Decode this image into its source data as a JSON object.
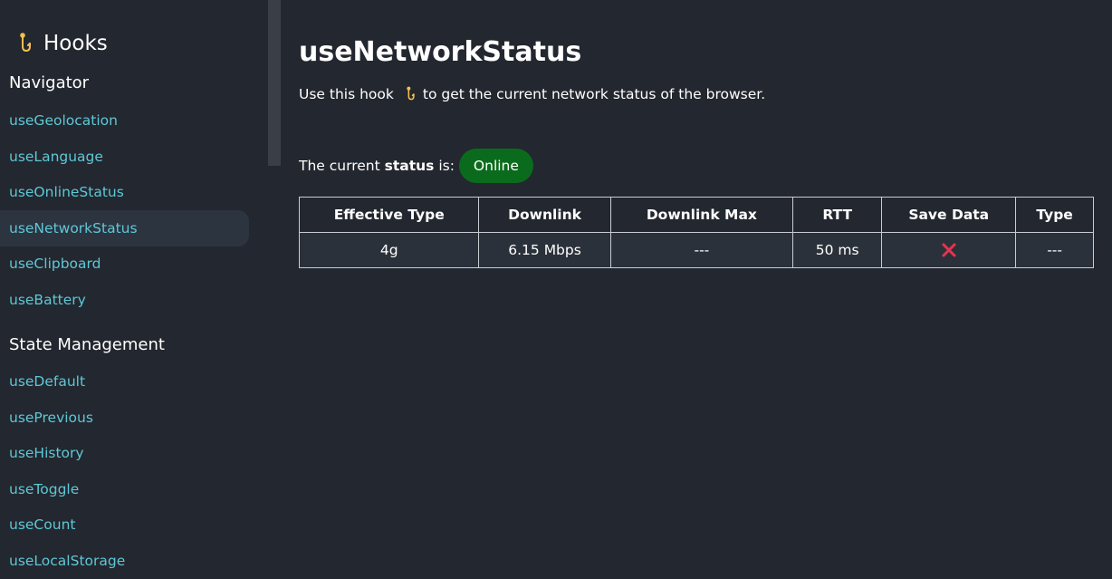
{
  "brand": {
    "title": "Hooks",
    "icon": "hook-icon"
  },
  "sidebar": {
    "sections": [
      {
        "heading": "Navigator",
        "items": [
          {
            "label": "useGeolocation"
          },
          {
            "label": "useLanguage"
          },
          {
            "label": "useOnlineStatus"
          },
          {
            "label": "useNetworkStatus",
            "active": true
          },
          {
            "label": "useClipboard"
          },
          {
            "label": "useBattery"
          }
        ]
      },
      {
        "heading": "State Management",
        "items": [
          {
            "label": "useDefault"
          },
          {
            "label": "usePrevious"
          },
          {
            "label": "useHistory"
          },
          {
            "label": "useToggle"
          },
          {
            "label": "useCount"
          },
          {
            "label": "useLocalStorage"
          }
        ]
      }
    ]
  },
  "main": {
    "title": "useNetworkStatus",
    "description_prefix": "Use this hook",
    "description_suffix": "to get the current network status of the browser.",
    "status_prefix": "The current",
    "status_bold": "status",
    "status_suffix": "is:",
    "status_value": "Online",
    "table": {
      "headers": [
        "Effective Type",
        "Downlink",
        "Downlink Max",
        "RTT",
        "Save Data",
        "Type"
      ],
      "row": [
        "4g",
        "6.15 Mbps",
        "---",
        "50 ms",
        "",
        "---"
      ],
      "save_data_icon": "cross-icon"
    }
  },
  "colors": {
    "background": "#23272f",
    "link": "#5ec8d6",
    "active_item": "#2c3440",
    "online_badge": "#0b6b1d",
    "cross": "#e8344e",
    "hook_icon": "#f5c04f"
  }
}
